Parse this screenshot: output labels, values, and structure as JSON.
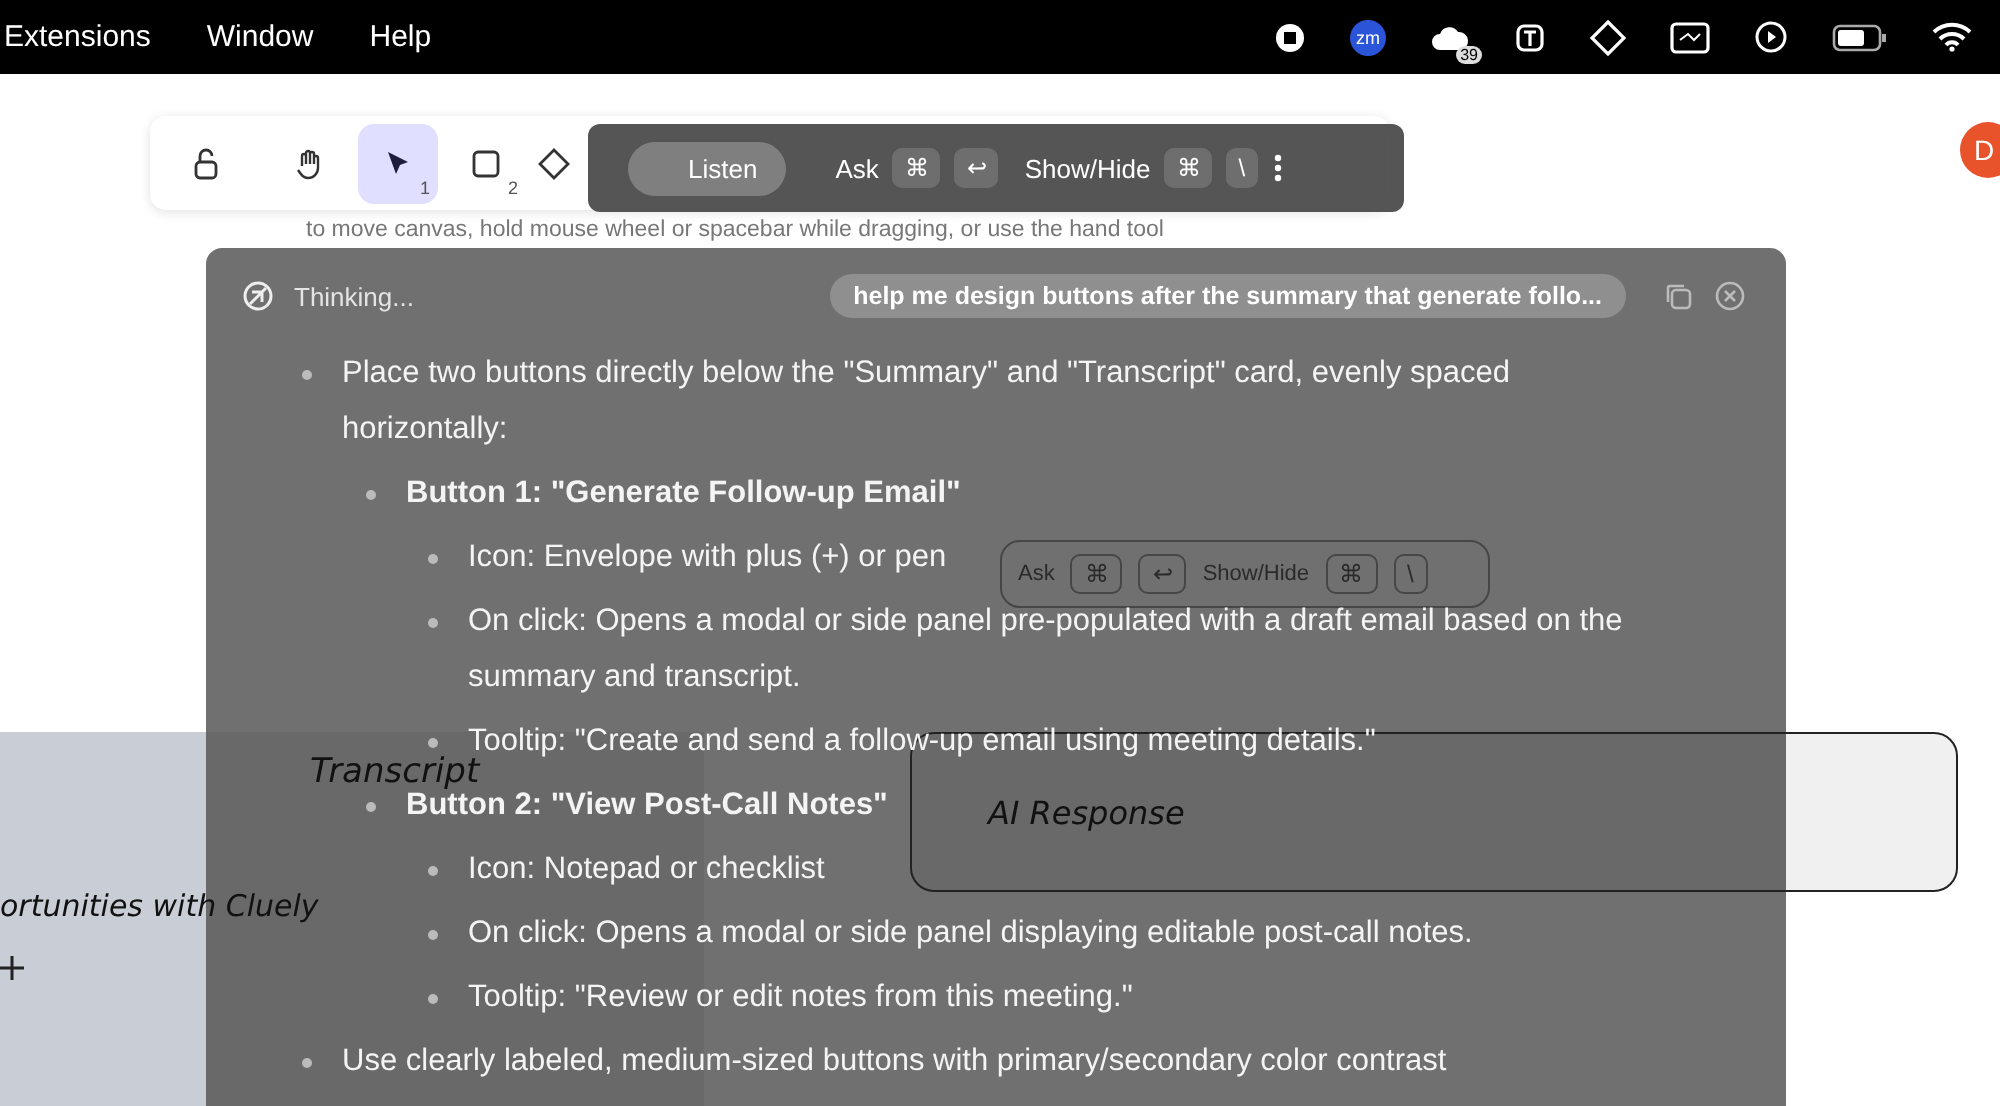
{
  "menubar": {
    "items": [
      "Extensions",
      "Window",
      "Help"
    ],
    "zoom_label": "zm",
    "badge": "39"
  },
  "toolbar": {
    "tools": [
      {
        "kind": "lock",
        "selected": false
      },
      {
        "kind": "hand",
        "selected": false
      },
      {
        "kind": "pointer",
        "key": "1",
        "selected": true
      },
      {
        "kind": "rectangle",
        "key": "2",
        "selected": false
      },
      {
        "kind": "diamond",
        "selected": false
      }
    ]
  },
  "overlay_bar": {
    "listen": "Listen",
    "actions": [
      {
        "label": "Ask",
        "keys": [
          "⌘",
          "↩"
        ]
      },
      {
        "label": "Show/Hide",
        "keys": [
          "⌘",
          "\\"
        ]
      }
    ]
  },
  "avatar": "D",
  "canvas": {
    "hint": "to move canvas, hold mouse wheel or spacebar while dragging, or use the hand tool",
    "transcript_title": "Transcript",
    "transcript_text": "ortunities with Cluely",
    "ai_title": "AI Response"
  },
  "panel": {
    "status": "Thinking...",
    "prompt": "help me design buttons after the summary that generate follo...",
    "bullets": [
      {
        "text": "Place two buttons directly below the \"Summary\" and \"Transcript\" card, evenly spaced horizontally:",
        "children": [
          {
            "text": "Button 1: \"Generate Follow-up Email\"",
            "children": [
              {
                "text": "Icon: Envelope with plus (+) or pen"
              },
              {
                "text": "On click: Opens a modal or side panel pre-populated with a draft email based on the summary and transcript."
              },
              {
                "text": "Tooltip: \"Create and send a follow-up email using meeting details.\""
              }
            ]
          },
          {
            "text": "Button 2: \"View Post-Call Notes\"",
            "children": [
              {
                "text": "Icon: Notepad or checklist"
              },
              {
                "text": "On click: Opens a modal or side panel displaying editable post-call notes."
              },
              {
                "text": "Tooltip: \"Review or edit notes from this meeting.\""
              }
            ]
          }
        ]
      },
      {
        "text": "Use clearly labeled, medium-sized buttons with primary/secondary color contrast"
      }
    ]
  },
  "ghost_bar": {
    "items": [
      {
        "kind": "label",
        "text": "Ask"
      },
      {
        "kind": "key",
        "text": "⌘"
      },
      {
        "kind": "key",
        "text": "↩"
      },
      {
        "kind": "label",
        "text": "Show/Hide"
      },
      {
        "kind": "key",
        "text": "⌘"
      },
      {
        "kind": "key",
        "text": "\\"
      }
    ]
  }
}
